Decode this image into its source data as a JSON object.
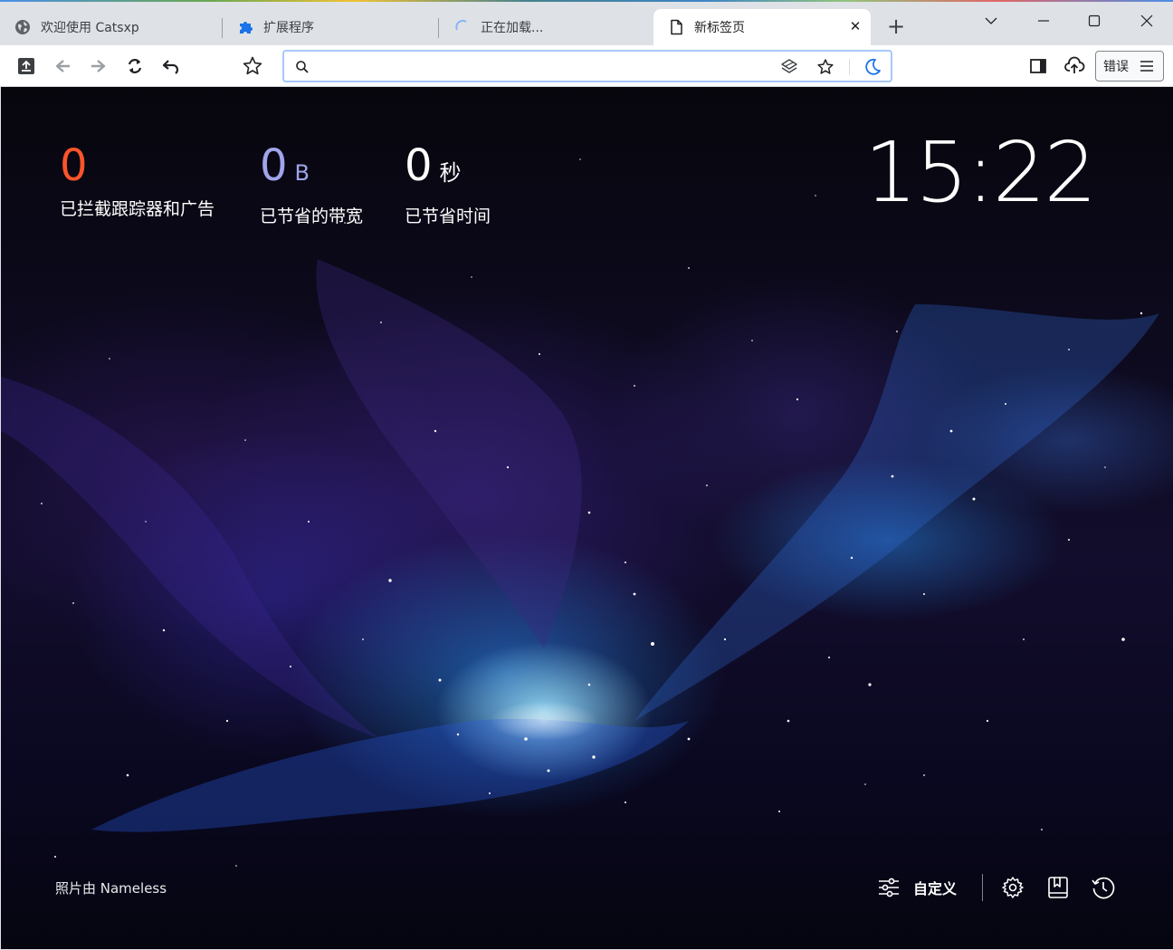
{
  "tabs": [
    {
      "title": "欢迎使用 Catsxp",
      "icon": "globe-icon"
    },
    {
      "title": "扩展程序",
      "icon": "puzzle-icon"
    },
    {
      "title": "正在加载...",
      "icon": "loading-spinner-icon"
    },
    {
      "title": "新标签页",
      "icon": "page-icon",
      "active": true
    }
  ],
  "tab_close_glyph": "✕",
  "new_tab_glyph": "+",
  "toolbar": {
    "omnibox_value": "",
    "error_label": "错误"
  },
  "ntp": {
    "stats": {
      "trackers": {
        "value": "0",
        "unit": "",
        "label": "已拦截跟踪器和广告"
      },
      "bandwidth": {
        "value": "0",
        "unit": "B",
        "label": "已节省的带宽"
      },
      "time": {
        "value": "0",
        "unit": "秒",
        "label": "已节省时间"
      }
    },
    "clock": "15:22",
    "photo_credit": "照片由 Nameless",
    "customize_label": "自定义"
  },
  "colors": {
    "trackers": "#fb542b",
    "bandwidth": "#a0a5eb",
    "omnibox_focus": "#a8c7fa",
    "accent": "#1a73e8"
  }
}
